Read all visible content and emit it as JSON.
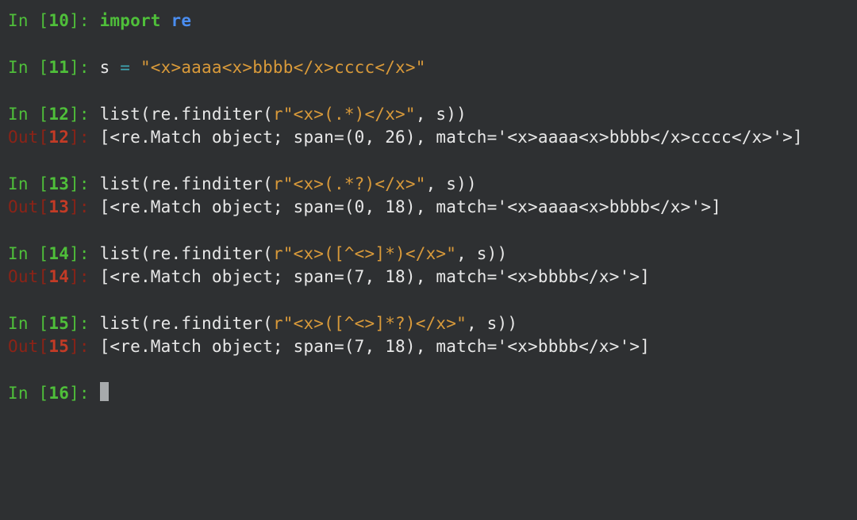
{
  "cells": [
    {
      "n": 10,
      "in_tokens": [
        {
          "cls": "green-b",
          "t": "import"
        },
        {
          "cls": "",
          "t": " "
        },
        {
          "cls": "blue-b",
          "t": "re"
        }
      ]
    },
    {
      "n": 11,
      "in_tokens": [
        {
          "cls": "",
          "t": "s "
        },
        {
          "cls": "teal",
          "t": "="
        },
        {
          "cls": "",
          "t": " "
        },
        {
          "cls": "orange",
          "t": "\"<x>aaaa<x>bbbb</x>cccc</x>\""
        }
      ]
    },
    {
      "n": 12,
      "in_tokens": [
        {
          "cls": "",
          "t": "list(re.finditer("
        },
        {
          "cls": "orange",
          "t": "r\"<x>(.*)</x>\""
        },
        {
          "cls": "",
          "t": ", s))"
        }
      ],
      "out": "[<re.Match object; span=(0, 26), match='<x>aaaa<x>bbbb</x>cccc</x>'>]"
    },
    {
      "n": 13,
      "in_tokens": [
        {
          "cls": "",
          "t": "list(re.finditer("
        },
        {
          "cls": "orange",
          "t": "r\"<x>(.*?)</x>\""
        },
        {
          "cls": "",
          "t": ", s))"
        }
      ],
      "out": "[<re.Match object; span=(0, 18), match='<x>aaaa<x>bbbb</x>'>]"
    },
    {
      "n": 14,
      "in_tokens": [
        {
          "cls": "",
          "t": "list(re.finditer("
        },
        {
          "cls": "orange",
          "t": "r\"<x>([^<>]*)</x>\""
        },
        {
          "cls": "",
          "t": ", s))"
        }
      ],
      "out": "[<re.Match object; span=(7, 18), match='<x>bbbb</x>'>]"
    },
    {
      "n": 15,
      "in_tokens": [
        {
          "cls": "",
          "t": "list(re.finditer("
        },
        {
          "cls": "orange",
          "t": "r\"<x>([^<>]*?)</x>\""
        },
        {
          "cls": "",
          "t": ", s))"
        }
      ],
      "out": "[<re.Match object; span=(7, 18), match='<x>bbbb</x>'>]"
    },
    {
      "n": 16,
      "in_tokens": [],
      "cursor": true
    }
  ]
}
